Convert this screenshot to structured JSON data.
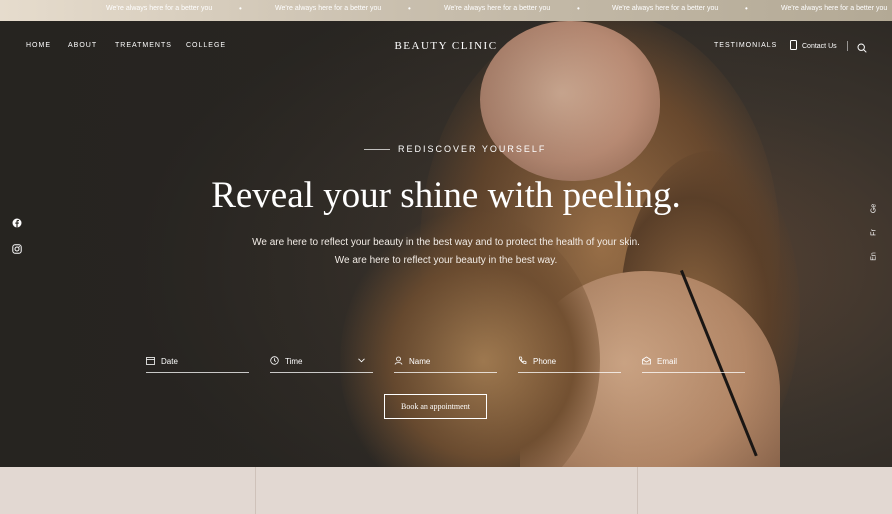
{
  "ticker": {
    "items": [
      "We're always here for a better you",
      "We're always here for a better you",
      "We're always here for a better you",
      "We're always here for a better you",
      "We're always here for a better you"
    ]
  },
  "nav": {
    "left": [
      "HOME",
      "ABOUT",
      "TREATMENTS",
      "COLLEGE"
    ],
    "brand": "BEAUTY CLINIC",
    "testimonials": "TESTIMONIALS",
    "contact": "Contact Us"
  },
  "hero": {
    "eyebrow": "REDISCOVER YOURSELF",
    "headline": "Reveal your shine with peeling.",
    "subtext": "We are here to reflect your beauty in the best way and to protect the health of your skin. We are here to reflect your beauty in the best way."
  },
  "booking": {
    "fields": [
      {
        "label": "Date",
        "icon": "calendar-icon"
      },
      {
        "label": "Time",
        "icon": "clock-icon"
      },
      {
        "label": "Name",
        "icon": "user-icon"
      },
      {
        "label": "Phone",
        "icon": "phone-icon"
      },
      {
        "label": "Email",
        "icon": "mail-icon"
      }
    ],
    "button": "Book an appointment"
  },
  "social": [
    "facebook-icon",
    "instagram-icon"
  ],
  "languages": [
    "Ge",
    "Fr",
    "En"
  ]
}
